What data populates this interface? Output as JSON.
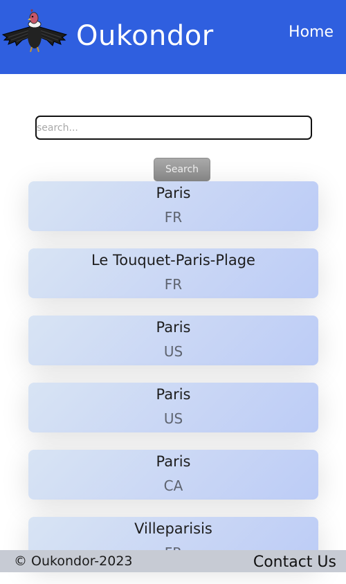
{
  "header": {
    "brand": "Oukondor",
    "nav_home": "Home"
  },
  "search": {
    "placeholder": "search...",
    "value": "",
    "button_label": "Search"
  },
  "results": [
    {
      "name": "Paris",
      "country": "FR"
    },
    {
      "name": "Le Touquet-Paris-Plage",
      "country": "FR"
    },
    {
      "name": "Paris",
      "country": "US"
    },
    {
      "name": "Paris",
      "country": "US"
    },
    {
      "name": "Paris",
      "country": "CA"
    },
    {
      "name": "Villeparisis",
      "country": "FR"
    }
  ],
  "footer": {
    "copyright": "© Oukondor-2023",
    "contact": "Contact Us"
  },
  "colors": {
    "header_bg": "#2f5fdf",
    "footer_bg": "#c7cbd4"
  }
}
